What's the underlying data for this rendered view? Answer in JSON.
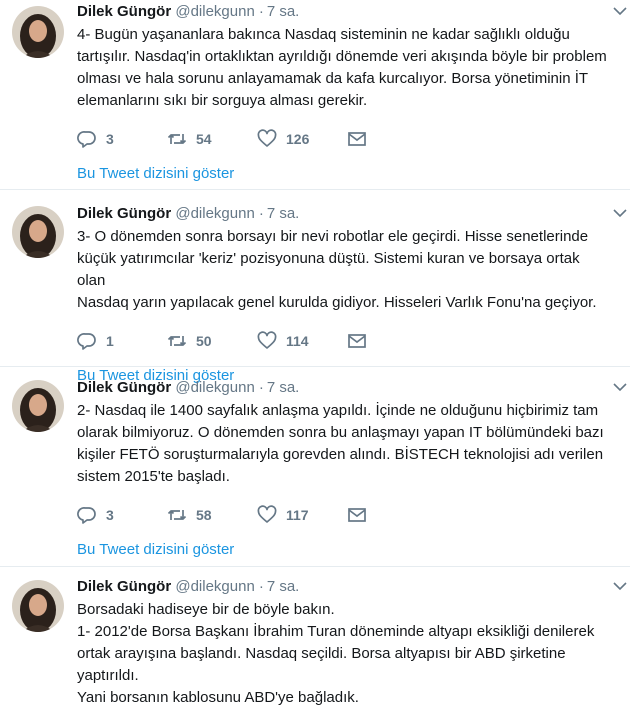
{
  "tweets": [
    {
      "author": "Dilek Güngör",
      "handle": "@dilekgunn",
      "separator": "·",
      "time": "7 sa.",
      "lines": [
        "4- Bugün yaşananlara bakınca  Nasdaq sisteminin ne kadar sağlıklı olduğu",
        "tartışılır. Nasdaq'in ortaklıktan ayrıldığı dönemde veri akışında böyle bir problem",
        "olması ve hala sorunu anlayamamak da kafa kurcalıyor. Borsa yönetiminin İT",
        "elemanlarını sıkı bir sorguya alması gerekir."
      ],
      "replies": "3",
      "retweets": "54",
      "likes": "126",
      "thread_link": "Bu Tweet dizisini göster"
    },
    {
      "author": "Dilek Güngör",
      "handle": "@dilekgunn",
      "separator": "·",
      "time": "7 sa.",
      "lines": [
        "3- O dönemden sonra borsayı bir nevi robotlar ele geçirdi. Hisse senetlerinde",
        "küçük yatırımcılar 'keriz' pozisyonuna düştü. Sistemi kuran ve borsaya ortak olan",
        "Nasdaq yarın yapılacak genel kurulda gidiyor. Hisseleri Varlık Fonu'na geçiyor."
      ],
      "replies": "1",
      "retweets": "50",
      "likes": "114",
      "thread_link": "Bu Tweet dizisini göster"
    },
    {
      "author": "Dilek Güngör",
      "handle": "@dilekgunn",
      "separator": "·",
      "time": "7 sa.",
      "lines": [
        "2- Nasdaq ile 1400 sayfalık anlaşma yapıldı. İçinde ne olduğunu hiçbirimiz tam",
        "olarak bilmiyoruz. O dönemden sonra bu anlaşmayı yapan IT bölümündeki bazı",
        "kişiler  FETÖ soruşturmalarıyla gorevden alındı. BİSTECH teknolojisi adı verilen",
        "sistem 2015'te başladı."
      ],
      "replies": "3",
      "retweets": "58",
      "likes": "117",
      "thread_link": "Bu Tweet dizisini göster"
    },
    {
      "author": "Dilek Güngör",
      "handle": "@dilekgunn",
      "separator": "·",
      "time": "7 sa.",
      "lines": [
        "Borsadaki hadiseye bir de böyle bakın.",
        "1- 2012'de Borsa Başkanı İbrahim Turan döneminde altyapı eksikliği denilerek",
        "ortak arayışına başlandı. Nasdaq seçildi. Borsa altyapısı bir ABD şirketine yaptırıldı.",
        "Yani borsanın kablosunu ABD'ye bağladık."
      ]
    }
  ],
  "colors": {
    "text": "#14171a",
    "muted": "#657786",
    "link": "#1b95e0",
    "divider": "#e6ecf0"
  },
  "icons": [
    "reply-icon",
    "retweet-icon",
    "like-icon",
    "direct-message-icon",
    "caret-down-icon"
  ]
}
